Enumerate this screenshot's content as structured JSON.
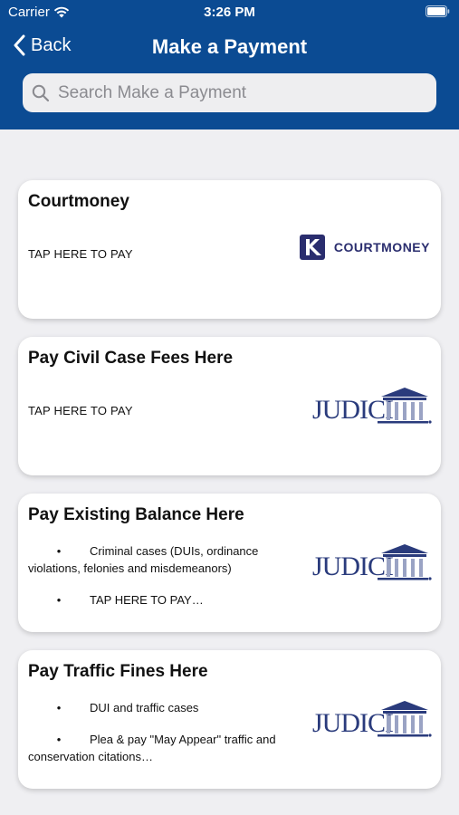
{
  "status": {
    "carrier": "Carrier",
    "time": "3:26 PM"
  },
  "nav": {
    "back_label": "Back",
    "title": "Make a Payment"
  },
  "search": {
    "placeholder": "Search Make a Payment"
  },
  "cards": [
    {
      "title": "Courtmoney",
      "subtitle": "TAP HERE TO PAY",
      "logo_text": "COURTMONEY"
    },
    {
      "title": "Pay Civil Case Fees Here",
      "subtitle": "TAP HERE TO PAY",
      "logo_text": "JUDICI"
    },
    {
      "title": "Pay Existing Balance Here",
      "bullet1_a": "Criminal cases (DUIs, ordinance",
      "bullet1_b": "violations, felonies and misdemeanors)",
      "bullet2": "TAP HERE TO PAY…",
      "logo_text": "JUDICI"
    },
    {
      "title": "Pay Traffic Fines Here",
      "bullet1": "DUI and traffic cases",
      "bullet2_a": "Plea & pay \"May Appear\" traffic and",
      "bullet2_b": "conservation citations…",
      "logo_text": "JUDICI"
    }
  ],
  "colors": {
    "header": "#0b4b93",
    "background": "#efeff2",
    "logo_navy": "#2a3b7c"
  }
}
